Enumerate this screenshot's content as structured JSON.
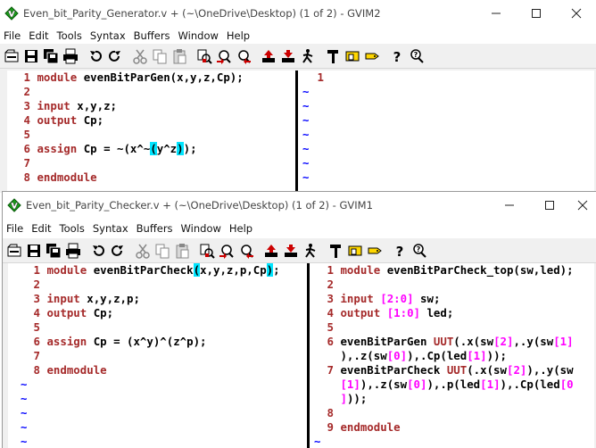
{
  "window1": {
    "title": "Even_bit_Parity_Generator.v + (~\\OneDrive\\Desktop) (1 of 2) - GVIM2",
    "menu": [
      "File",
      "Edit",
      "Tools",
      "Syntax",
      "Buffers",
      "Window",
      "Help"
    ],
    "left_pane": {
      "lines": [
        {
          "n": "1",
          "code": "module evenBitParGen(x,y,z,Cp);"
        },
        {
          "n": "2",
          "code": ""
        },
        {
          "n": "3",
          "code": "input x,y,z;"
        },
        {
          "n": "4",
          "code": "output Cp;"
        },
        {
          "n": "5",
          "code": ""
        },
        {
          "n": "6",
          "code": "assign Cp = ~(x^~(y^z));"
        },
        {
          "n": "7",
          "code": ""
        },
        {
          "n": "8",
          "code": "endmodule"
        }
      ]
    },
    "right_pane": {
      "lines": [
        {
          "n": "1",
          "code": ""
        }
      ]
    }
  },
  "window2": {
    "title": "Even_bit_Parity_Checker.v + (~\\OneDrive\\Desktop) (1 of 2) - GVIM1",
    "menu": [
      "File",
      "Edit",
      "Tools",
      "Syntax",
      "Buffers",
      "Window",
      "Help"
    ],
    "left_pane": {
      "lines": [
        {
          "n": "1",
          "code": "module evenBitParCheck(x,y,z,p,Cp);"
        },
        {
          "n": "2",
          "code": ""
        },
        {
          "n": "3",
          "code": "input x,y,z,p;"
        },
        {
          "n": "4",
          "code": "output Cp;"
        },
        {
          "n": "5",
          "code": ""
        },
        {
          "n": "6",
          "code": "assign Cp = (x^y)^(z^p);"
        },
        {
          "n": "7",
          "code": ""
        },
        {
          "n": "8",
          "code": "endmodule"
        }
      ]
    },
    "right_pane": {
      "lines": [
        {
          "n": "1",
          "code": "module evenBitParCheck_top(sw,led);"
        },
        {
          "n": "2",
          "code": ""
        },
        {
          "n": "3",
          "code": "input [2:0] sw;"
        },
        {
          "n": "4",
          "code": "output [1:0] led;"
        },
        {
          "n": "5",
          "code": ""
        },
        {
          "n": "6",
          "code": "evenBitParGen UUT(.x(sw[2],.y(sw[1]),.z(sw[0]),.Cp(led[1]));"
        },
        {
          "n": "7",
          "code": "evenBitParCheck UUT(.x(sw[2]),.y(sw[1]),.z(sw[0]),.p(led[1]),.Cp(led[0]));"
        },
        {
          "n": "8",
          "code": ""
        },
        {
          "n": "9",
          "code": "endmodule"
        }
      ]
    }
  },
  "tilde": "~",
  "window_controls": {
    "minimize": "minimize-icon",
    "maximize": "maximize-icon",
    "close": "close-icon"
  },
  "toolbar_icons": [
    "open-icon",
    "save-icon",
    "save-all-icon",
    "print-icon",
    "undo-icon",
    "redo-icon",
    "cut-icon",
    "copy-icon",
    "paste-icon",
    "replace-icon",
    "find-next-icon",
    "find-prev-icon",
    "load-session-icon",
    "save-session-icon",
    "run-script-icon",
    "make-icon",
    "shell-icon",
    "tags-icon",
    "help-icon",
    "find-help-icon"
  ]
}
